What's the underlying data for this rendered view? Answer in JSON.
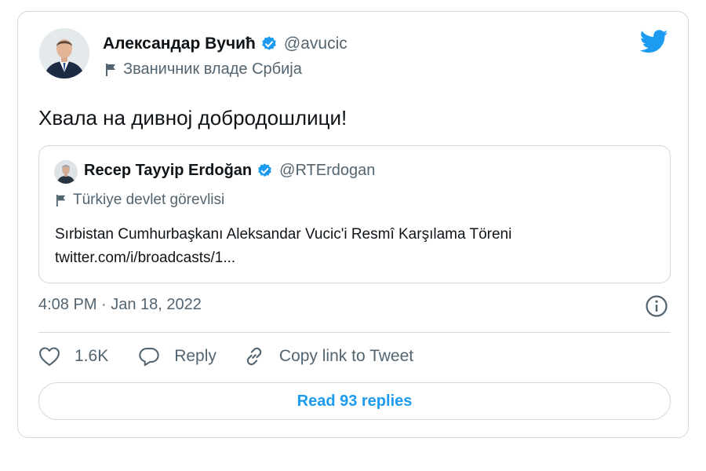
{
  "tweet": {
    "author": {
      "name": "Александар Вучић",
      "handle": "@avucic",
      "label": "Званичник владе Србија",
      "verified": true
    },
    "text": "Хвала на дивној добродошлици!",
    "quoted": {
      "author": {
        "name": "Recep Tayyip Erdoğan",
        "handle": "@RTErdogan",
        "label": "Türkiye devlet görevlisi",
        "verified": true
      },
      "text_line1": "Sırbistan Cumhurbaşkanı Aleksandar Vucic'i Resmî Karşılama Töreni",
      "text_line2": "twitter.com/i/broadcasts/1..."
    },
    "timestamp": "4:08 PM · Jan 18, 2022",
    "actions": {
      "like_count": "1.6K",
      "reply_label": "Reply",
      "copy_link_label": "Copy link to Tweet"
    },
    "read_replies_label": "Read 93 replies"
  },
  "icons": {
    "logo": "twitter-bird-icon",
    "verified": "verified-badge-icon",
    "label": "flag-icon",
    "info": "info-icon",
    "like": "heart-icon",
    "reply": "speech-bubble-icon",
    "copy": "link-icon"
  },
  "colors": {
    "accent": "#1d9bf0",
    "text": "#0f1419",
    "secondary": "#536471",
    "border": "#cfd9de"
  }
}
